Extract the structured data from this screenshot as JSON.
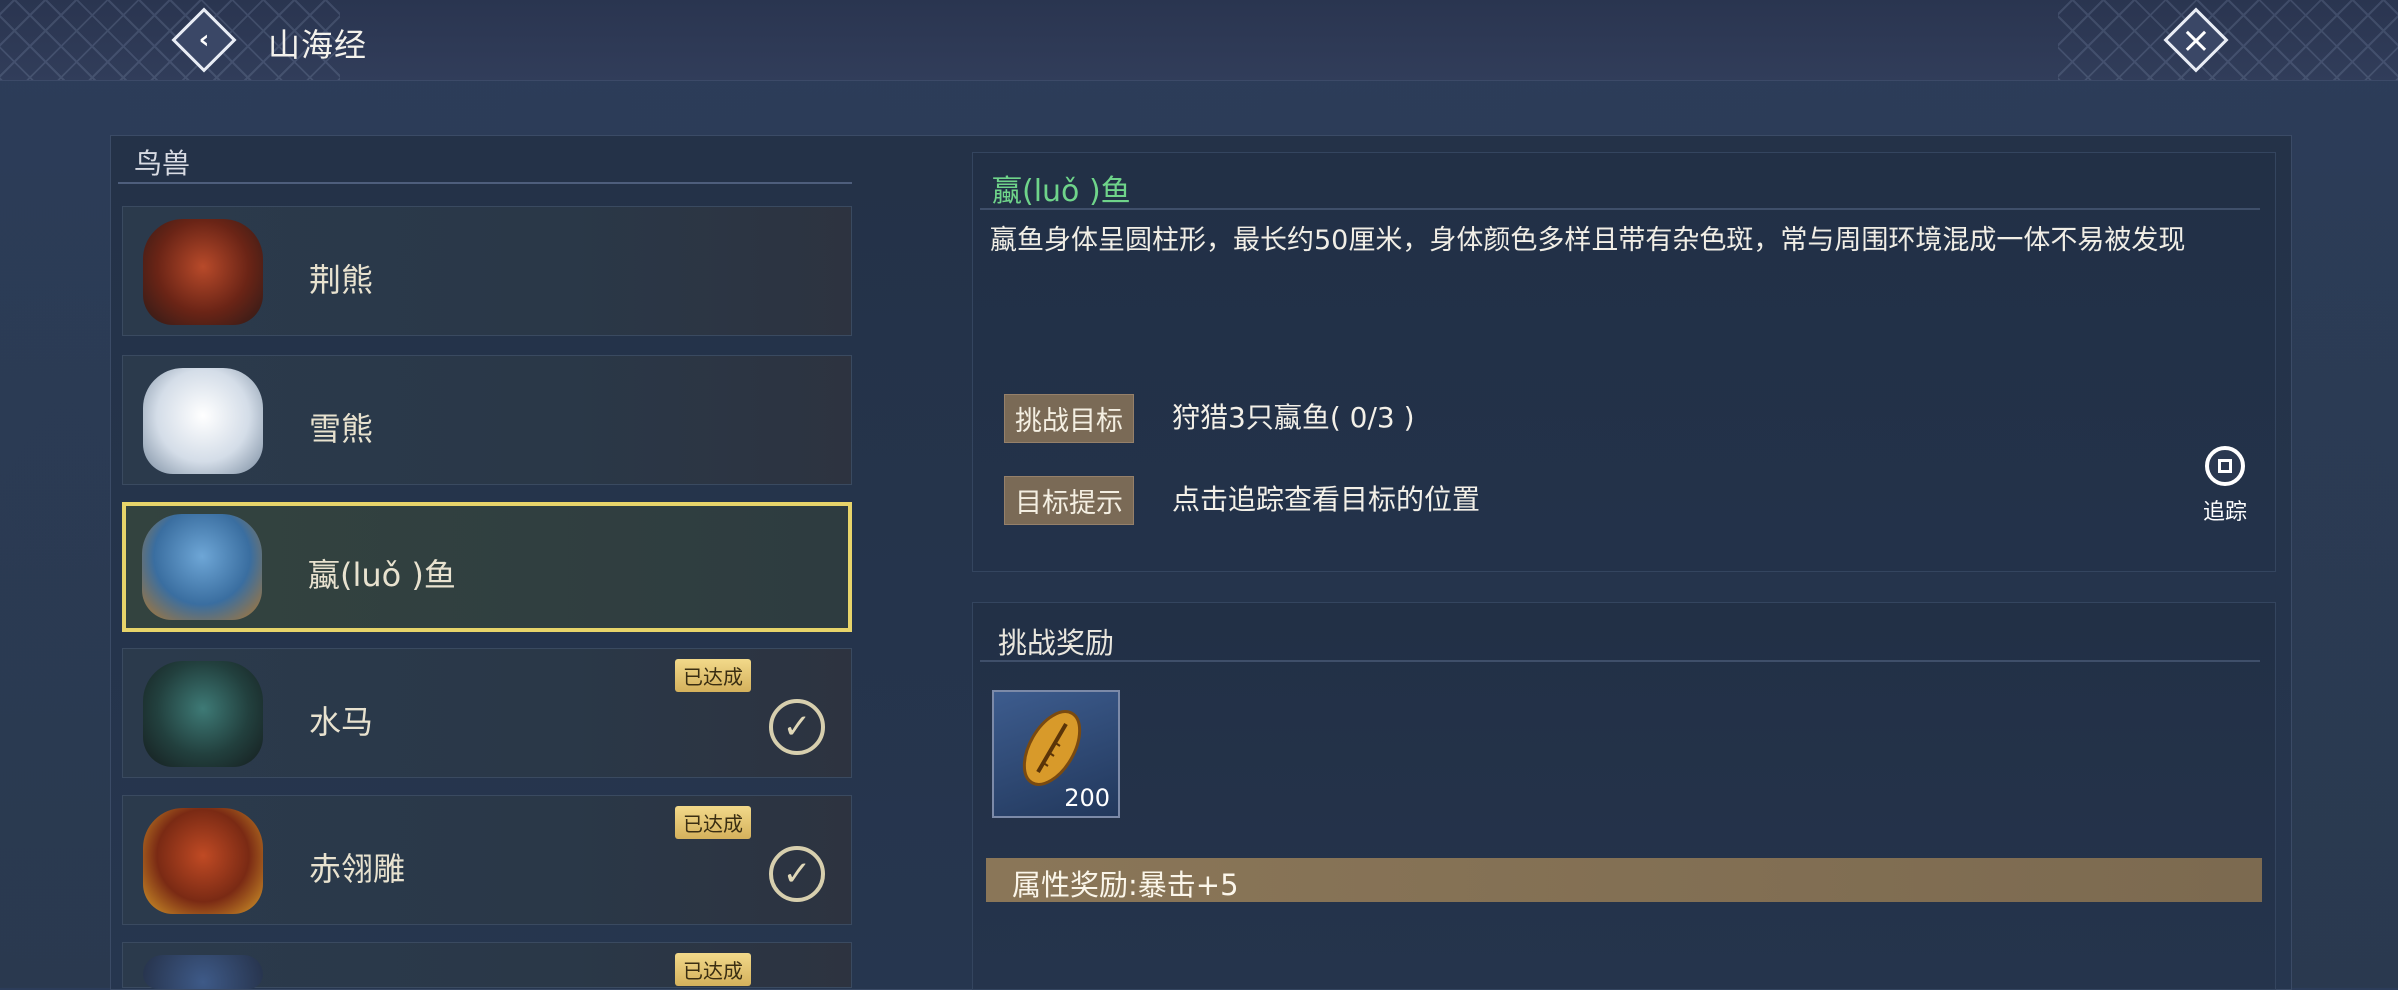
{
  "header": {
    "title": "山海经"
  },
  "sidebar": {
    "category": "鸟兽",
    "items": [
      {
        "name": "荆熊",
        "completed": false,
        "selected": false
      },
      {
        "name": "雪熊",
        "completed": false,
        "selected": false
      },
      {
        "name": "蠃(luǒ )鱼",
        "completed": false,
        "selected": true
      },
      {
        "name": "水马",
        "completed": true,
        "badge": "已达成",
        "selected": false
      },
      {
        "name": "赤翎雕",
        "completed": true,
        "badge": "已达成",
        "selected": false
      },
      {
        "name": "",
        "completed": true,
        "badge": "已达成",
        "selected": false
      }
    ]
  },
  "detail": {
    "title": "蠃(luǒ )鱼",
    "description": "蠃鱼身体呈圆柱形，最长约50厘米，身体颜色多样且带有杂色斑，常与周围环境混成一体不易被发现",
    "challenge_label": "挑战目标",
    "challenge_value": "狩猎3只蠃鱼( 0/3 )",
    "hint_label": "目标提示",
    "hint_value": "点击追踪查看目标的位置",
    "track_label": "追踪"
  },
  "reward": {
    "title": "挑战奖励",
    "item_count": "200",
    "attribute": "属性奖励:暴击+5"
  },
  "colors": {
    "selected_border": "#e7d46a",
    "title_green": "#6fd48a",
    "tag_bg": "#7a6a56"
  }
}
